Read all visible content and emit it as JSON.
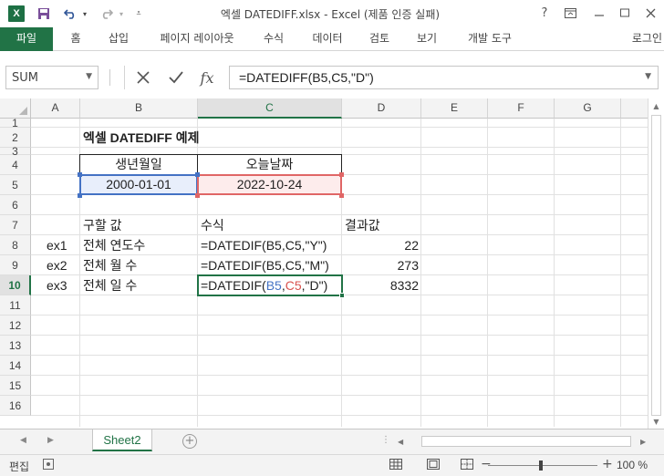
{
  "window": {
    "title": "엑셀 DATEDIFF.xlsx - Excel (제품 인증 실패)",
    "help": "?",
    "logo": "X"
  },
  "ribbon": {
    "tabs": [
      "파일",
      "홈",
      "삽입",
      "페이지 레이아웃",
      "수식",
      "데이터",
      "검토",
      "보기",
      "개발 도구"
    ],
    "login": "로그인"
  },
  "formula_bar": {
    "name_box": "SUM",
    "formula": "=DATEDIFF(B5,C5,\"D\")",
    "cancel_icon": "✕",
    "enter_icon": "✓",
    "fx": "fx"
  },
  "columns": [
    "A",
    "B",
    "C",
    "D",
    "E",
    "F",
    "G"
  ],
  "selected_column": "C",
  "rows": [
    "1",
    "2",
    "3",
    "4",
    "5",
    "6",
    "7",
    "8",
    "9",
    "10",
    "11",
    "12",
    "13",
    "14",
    "15",
    "16"
  ],
  "selected_row": "10",
  "cells": {
    "title": "엑셀 DATEDIFF 예제",
    "birth_header": "생년월일",
    "today_header": "오늘날짜",
    "birth_date": "2000-01-01",
    "today_date": "2022-10-24",
    "h_kind": "구할 값",
    "h_formula": "수식",
    "h_result": "결과값",
    "rows": [
      {
        "id": "ex1",
        "kind": "전체 연도수",
        "formula": "=DATEDIF(B5,C5,\"Y\")",
        "result": "22"
      },
      {
        "id": "ex2",
        "kind": "전체 월 수",
        "formula": "=DATEDIF(B5,C5,\"M\")",
        "result": "273"
      },
      {
        "id": "ex3",
        "kind": "전체 일 수",
        "formula_parts": [
          "=DATEDIF(",
          "B5",
          ",",
          "C5",
          ",\"D\")"
        ],
        "result": "8332"
      }
    ]
  },
  "sheet_tabs": [
    "Sheet2"
  ],
  "status": {
    "mode": "편집",
    "zoom": "100 %",
    "zoom_minus": "−",
    "zoom_plus": "+"
  }
}
